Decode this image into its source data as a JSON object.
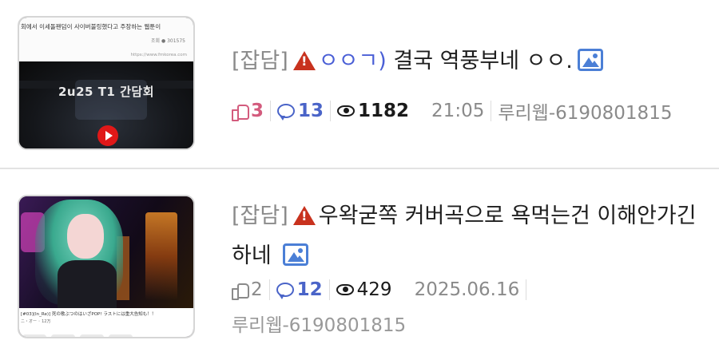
{
  "posts": [
    {
      "category": "[잡담]",
      "title_prefix": "ㅇㅇㄱ)",
      "title_text": "결국 역풍부네 ㅇㅇ.",
      "likes": "3",
      "comments": "13",
      "views": "1182",
      "time": "21:05",
      "author": "루리웹-6190801815",
      "thumbnail": {
        "headline": "회에서 이세돌팬덤이 사이버불링했다고 주장하는 웹툰이",
        "meta": "조회 ● 301575",
        "url": "https://www.fmkorea.com",
        "title": "2u25 T1 간담회"
      }
    },
    {
      "category": "[잡담]",
      "title_text": "우왁굳쪽 커버곡으로 욕먹는건 이해안가긴하네",
      "likes": "2",
      "comments": "12",
      "views": "429",
      "time": "2025.06.16",
      "author": "루리웹-6190801815",
      "thumbnail": {
        "caption": "[#03](In_Re)] 死の歌ぶつのはいざPOP! ラストには重大告知も！！",
        "channel": "ニ・オー ◦ 12万"
      }
    }
  ],
  "colors": {
    "warning": "#c8321e",
    "accent_blue": "#4a5fd6",
    "like_pink": "#d35b7d",
    "comment_blue": "#4a64c8",
    "muted": "#999999"
  },
  "icons": [
    "warning-icon",
    "image-icon",
    "like-icon",
    "comment-icon",
    "view-icon",
    "play-icon"
  ]
}
